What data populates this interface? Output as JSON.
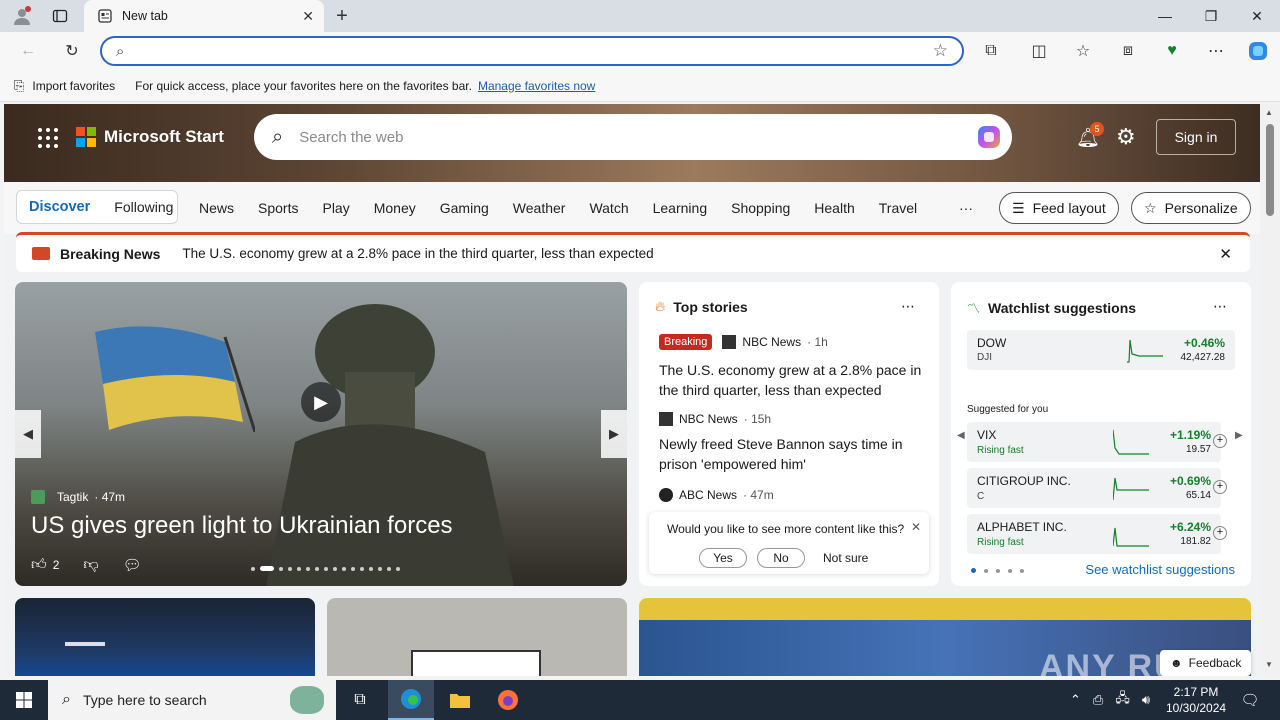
{
  "browser": {
    "tab_title": "New tab",
    "addr_placeholder": "",
    "fav_import": "Import favorites",
    "fav_hint": "For quick access, place your favorites here on the favorites bar.",
    "fav_manage": "Manage favorites now"
  },
  "msn": {
    "brand": "Microsoft Start",
    "search_placeholder": "Search the web",
    "notif_count": "5",
    "signin": "Sign in",
    "nav_tabs": [
      "Discover",
      "Following"
    ],
    "nav_items": [
      "News",
      "Sports",
      "Play",
      "Money",
      "Gaming",
      "Weather",
      "Watch",
      "Learning",
      "Shopping",
      "Health",
      "Travel"
    ],
    "more": "···",
    "feed_layout": "Feed layout",
    "personalize": "Personalize",
    "breaking_label": "Breaking News",
    "breaking_text": "The U.S. economy grew at a 2.8% pace in the third quarter, less than expected"
  },
  "main_story": {
    "source": "Tagtik",
    "time": "· 47m",
    "headline": "US gives green light to Ukrainian forces",
    "likes": "2"
  },
  "top_stories": {
    "title": "Top stories",
    "items": [
      {
        "badge": "Breaking",
        "source": "NBC News",
        "time": "· 1h",
        "headline": "The U.S. economy grew at a 2.8% pace in the third quarter, less than expected"
      },
      {
        "badge": "",
        "source": "NBC News",
        "time": "· 15h",
        "headline": "Newly freed Steve Bannon says time in prison 'empowered him'"
      },
      {
        "badge": "",
        "source": "ABC News",
        "time": "· 47m",
        "headline": ""
      }
    ],
    "feedback_q": "Would you like to see more content like this?",
    "yes": "Yes",
    "no": "No",
    "not_sure": "Not sure"
  },
  "watchlist": {
    "title": "Watchlist suggestions",
    "top": {
      "name": "DOW",
      "ticker": "DJI",
      "change": "+0.46%",
      "price": "42,427.28"
    },
    "suggested_label": "Suggested for you",
    "items": [
      {
        "name": "VIX",
        "sub": "Rising fast",
        "change": "+1.19%",
        "price": "19.57"
      },
      {
        "name": "CITIGROUP INC.",
        "sub": "C",
        "change": "+0.69%",
        "price": "65.14"
      },
      {
        "name": "ALPHABET INC.",
        "sub": "Rising fast",
        "change": "+6.24%",
        "price": "181.82"
      }
    ],
    "see_more": "See watchlist suggestions"
  },
  "feedback_btn": "Feedback",
  "watermark": "ANY RUN",
  "taskbar": {
    "search": "Type here to search",
    "time": "2:17 PM",
    "date": "10/30/2024"
  },
  "colors": {
    "accent": "#0f6cbd",
    "breaking": "#d24726",
    "positive": "#13822b"
  }
}
